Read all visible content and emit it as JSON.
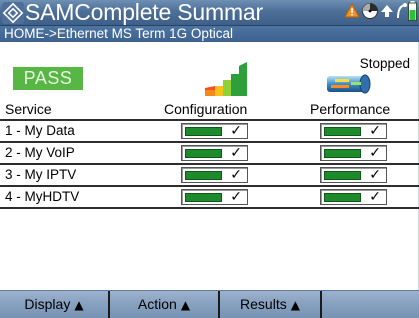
{
  "titlebar": {
    "title": "SAMComplete Summar",
    "icons": [
      "samcomplete-logo-icon",
      "alarm-icon",
      "clock-icon",
      "arrow-icon",
      "connection-icon",
      "battery-icon"
    ]
  },
  "breadcrumb": {
    "path": "HOME->Ethernet MS Term 1G Optical"
  },
  "status": {
    "result": "PASS",
    "state": "Stopped",
    "pass_color": "#58b645"
  },
  "table": {
    "headers": {
      "service": "Service",
      "configuration": "Configuration",
      "performance": "Performance"
    },
    "rows": [
      {
        "service": "1 - My Data",
        "configuration": "pass",
        "performance": "pass"
      },
      {
        "service": "2 - My VoIP",
        "configuration": "pass",
        "performance": "pass"
      },
      {
        "service": "3 - My IPTV",
        "configuration": "pass",
        "performance": "pass"
      },
      {
        "service": "4 - MyHDTV",
        "configuration": "pass",
        "performance": "pass"
      }
    ],
    "check_glyph": "✓",
    "indicator_color": "#1f8a2c"
  },
  "menubar": {
    "display": "Display",
    "action": "Action",
    "results": "Results",
    "arrow_glyph": "▲"
  }
}
